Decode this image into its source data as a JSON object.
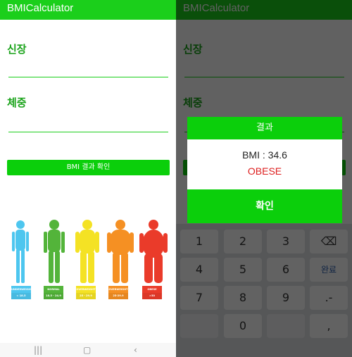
{
  "app": {
    "title": "BMICalculator"
  },
  "form": {
    "height_label": "신장",
    "weight_label": "체중",
    "height_value": "",
    "weight_value": "",
    "check_button": "BMI 결과 확인"
  },
  "categories": [
    {
      "name": "UNDERWEIGHT",
      "range": "< 18.5",
      "color": "#4dc6ef"
    },
    {
      "name": "NORMAL",
      "range": "18.5 - 24.9",
      "color": "#53b43a"
    },
    {
      "name": "OVERWEIGHT",
      "range": "25 - 29.9",
      "color": "#f4e224"
    },
    {
      "name": "OVERWEIGHT",
      "range": "25-29.9",
      "color": "#f59023"
    },
    {
      "name": "OBESE",
      "range": ">30",
      "color": "#ea3b2a"
    }
  ],
  "dialog": {
    "title": "결과",
    "bmi_text": "BMI : 34.6",
    "classification": "OBESE",
    "confirm": "확인"
  },
  "keyboard": {
    "keys": [
      "1",
      "2",
      "3",
      "4",
      "5",
      "6",
      "7",
      "8",
      "9",
      "0"
    ],
    "done_label": "완료",
    "minus_label": ".-",
    "dot_label": ",",
    "backspace_icon": "backspace-icon"
  },
  "nav": {
    "recents_icon": "recents-icon",
    "home_icon": "home-icon",
    "back_icon": "back-icon",
    "hide_keyboard_icon": "hide-keyboard-icon"
  }
}
